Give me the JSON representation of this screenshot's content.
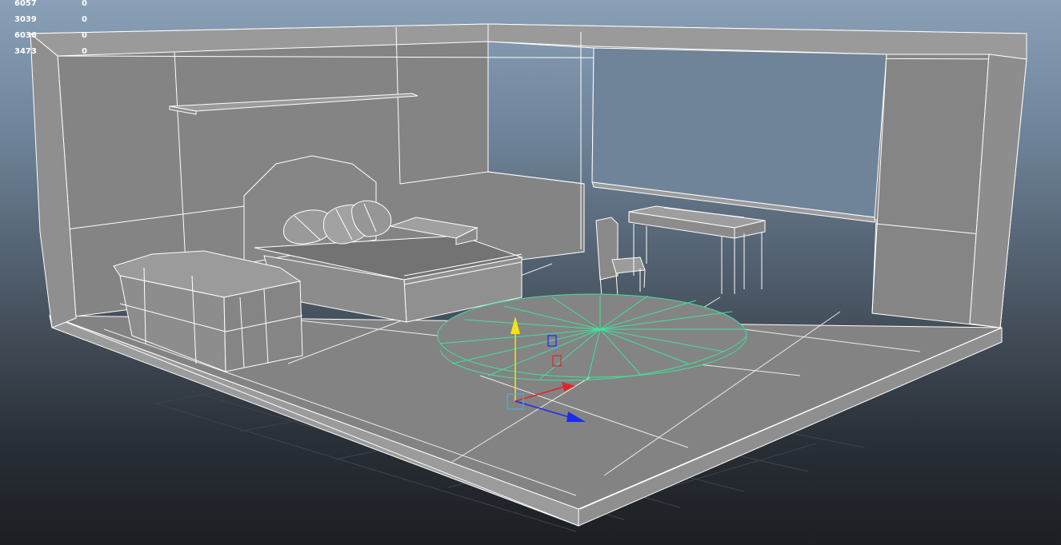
{
  "viewport": {
    "name": "Maya perspective viewport",
    "shading": "wireframe on shaded",
    "background_top": "#8aa0b6",
    "background_bottom": "#1b1e22"
  },
  "heads_up_display": {
    "rows": [
      {
        "value": "6057",
        "count": "0"
      },
      {
        "value": "3039",
        "count": "0"
      },
      {
        "value": "6036",
        "count": "0"
      },
      {
        "value": "3473",
        "count": "0"
      }
    ]
  },
  "scene": {
    "objects": [
      "room-walls",
      "window",
      "wall-shelf",
      "bed",
      "pillows",
      "nightstand",
      "ottoman-chest",
      "chair",
      "desk",
      "round-rug"
    ],
    "selected_object": "round-rug",
    "selection_color": "#3fe29a",
    "wire_color": "#ffffff",
    "manipulator": {
      "type": "move-tool",
      "x_axis_color": "#e0262a",
      "y_axis_color": "#f2e418",
      "z_axis_color": "#1a2cf0",
      "center_color": "#3fb4e0"
    }
  }
}
